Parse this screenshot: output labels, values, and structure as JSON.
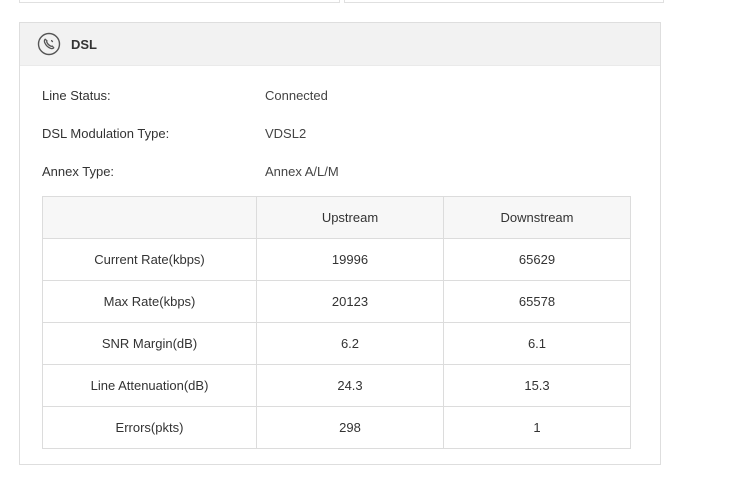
{
  "panel": {
    "title": "DSL",
    "icon": "phone-icon"
  },
  "info": {
    "line_status_label": "Line Status:",
    "line_status_value": "Connected",
    "modulation_label": "DSL Modulation Type:",
    "modulation_value": "VDSL2",
    "annex_label": "Annex Type:",
    "annex_value": "Annex A/L/M"
  },
  "table": {
    "headers": [
      "",
      "Upstream",
      "Downstream"
    ],
    "rows": [
      {
        "label": "Current Rate(kbps)",
        "upstream": "19996",
        "downstream": "65629"
      },
      {
        "label": "Max Rate(kbps)",
        "upstream": "20123",
        "downstream": "65578"
      },
      {
        "label": "SNR Margin(dB)",
        "upstream": "6.2",
        "downstream": "6.1"
      },
      {
        "label": "Line Attenuation(dB)",
        "upstream": "24.3",
        "downstream": "15.3"
      },
      {
        "label": "Errors(pkts)",
        "upstream": "298",
        "downstream": "1"
      }
    ]
  }
}
